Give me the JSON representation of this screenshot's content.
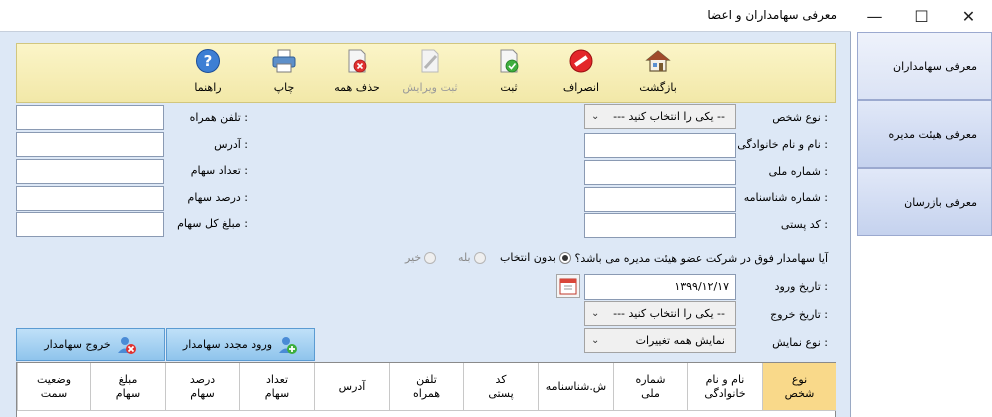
{
  "window": {
    "title": "معرفی سهامداران و اعضا",
    "controls": {
      "minimize": "—",
      "maximize": "☐",
      "close": "✕"
    }
  },
  "toolbar": {
    "back": "بازگشت",
    "cancel": "انصراف",
    "save": "ثبت",
    "save_edit": "ثبت ویرایش",
    "delete_all": "حذف همه",
    "print": "چاپ",
    "help": "راهنما"
  },
  "form": {
    "person_type_label": "نوع شخص :",
    "person_type_value": "--- یکی را انتخاب کنید --",
    "full_name_label": "نام و نام خانوادگی :",
    "national_id_label": "شماره ملی :",
    "birth_cert_label": "شماره شناسنامه :",
    "postal_code_label": "کد پستی :",
    "mobile_label": "تلفن همراه :",
    "address_label": "آدرس :",
    "share_count_label": "تعداد سهام :",
    "share_percent_label": "درصد سهام :",
    "share_amount_label": "مبلغ کل سهام :",
    "board_question": "آیا سهامدار فوق در شرکت عضو هیئت مدیره می باشد؟",
    "radio_none": "بدون انتخاب",
    "radio_yes": "بله",
    "radio_no": "خیر",
    "entry_date_label": "تاریخ ورود :",
    "entry_date_value": "۱۳۹۹/۱۲/۱۷",
    "exit_date_label": "تاریخ خروج :",
    "exit_date_value": "--- یکی را انتخاب کنید --",
    "display_type_label": "نوع نمایش :",
    "display_type_value": "نمایش همه تغییرات"
  },
  "actions": {
    "reenter": "ورود مجدد سهامدار",
    "exit": "خروج سهامدار"
  },
  "grid": {
    "columns": [
      "نوع\nشخص",
      "نام و نام\nخانوادگی",
      "شماره\nملی",
      "ش.شناسنامه",
      "کد\nپستی",
      "تلفن\nهمراه",
      "آدرس",
      "تعداد\nسهام",
      "درصد\nسهام",
      "مبلغ\nسهام",
      "وضعیت\nسمت"
    ]
  },
  "side_tabs": [
    "معرفی سهامداران",
    "معرفی هیئت مدیره",
    "معرفی بازرسان"
  ],
  "colors": {
    "toolbar_bg": "#f5ecb2",
    "form_bg": "#dde8f6",
    "active_header": "#f9d98a",
    "button_blue": "#a7d2f3"
  },
  "icons": {
    "back": "house-icon",
    "cancel": "cancel-icon",
    "save": "check-document-icon",
    "save_edit": "edit-icon",
    "delete_all": "delete-document-icon",
    "print": "printer-icon",
    "help": "help-icon",
    "calendar": "calendar-icon"
  }
}
